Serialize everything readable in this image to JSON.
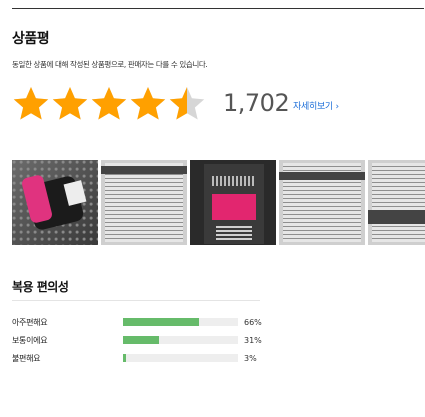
{
  "review": {
    "title": "상품평",
    "subtitle": "동일한 상품에 대해 작성된 상품평으로, 판매자는 다를 수 있습니다.",
    "rating": 4.5,
    "count": "1,702",
    "detail_link": "자세히보기",
    "colors": {
      "star": "#ffa000",
      "star_empty": "#d6d6d6",
      "link": "#1e6fd9"
    }
  },
  "photos": [
    {
      "icon": "pink-bottle-photo"
    },
    {
      "icon": "label-text-photo"
    },
    {
      "icon": "product-box-photo"
    },
    {
      "icon": "label-text-photo"
    },
    {
      "icon": "label-text-photo"
    }
  ],
  "ease": {
    "title": "복용 편의성",
    "rows": [
      {
        "label": "아주편해요",
        "percent": 66,
        "percent_text": "66%"
      },
      {
        "label": "보통이에요",
        "percent": 31,
        "percent_text": "31%"
      },
      {
        "label": "불편해요",
        "percent": 3,
        "percent_text": "3%"
      }
    ],
    "bar_color": "#66bb6a"
  }
}
